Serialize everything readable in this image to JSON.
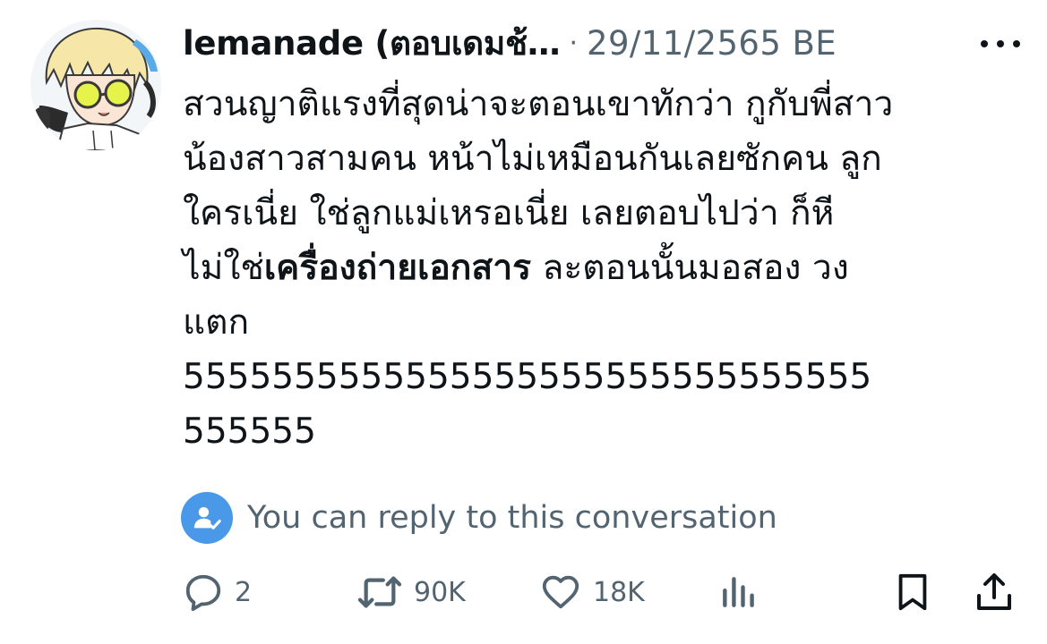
{
  "tweet": {
    "author_name": "lemanade (ตอบเดมช้…",
    "separator": "·",
    "date": "29/11/2565 BE",
    "text_lines": {
      "l1": "สวนญาติแรงที่สุดน่าจะตอนเขาทักว่า กูกับพี่สาว",
      "l2": "น้องสาวสามคน หน้าไม่เหมือนกันเลยซักคน ลูก",
      "l3": "ใครเนี่ย ใช่ลูกแม่เหรอเนี่ย เลยตอบไปว่า ก็หี",
      "l4_start": "ไม่ใช่",
      "l4_bold": "เครื่องถ่ายเอกสาร",
      "l4_end": " ละตอนนั้นมอสอง วง",
      "l5": "แตก",
      "l6": "5555555555555555555555555555555",
      "l7": "555555"
    }
  },
  "reply_notice": {
    "label": "You can reply to this conversation",
    "icon": "person-check-icon"
  },
  "actions": {
    "reply_count": "2",
    "retweet_count": "90K",
    "like_count": "18K"
  },
  "icons": {
    "reply": "speech-bubble-icon",
    "retweet": "retweet-arrows-icon",
    "like": "heart-icon",
    "views": "bar-chart-icon",
    "bookmark": "bookmark-icon",
    "share": "share-upload-icon",
    "more": "more-dots-icon"
  },
  "colors": {
    "text_primary": "#0f1419",
    "text_secondary": "#536471",
    "accent_blue": "#4a99e9"
  }
}
